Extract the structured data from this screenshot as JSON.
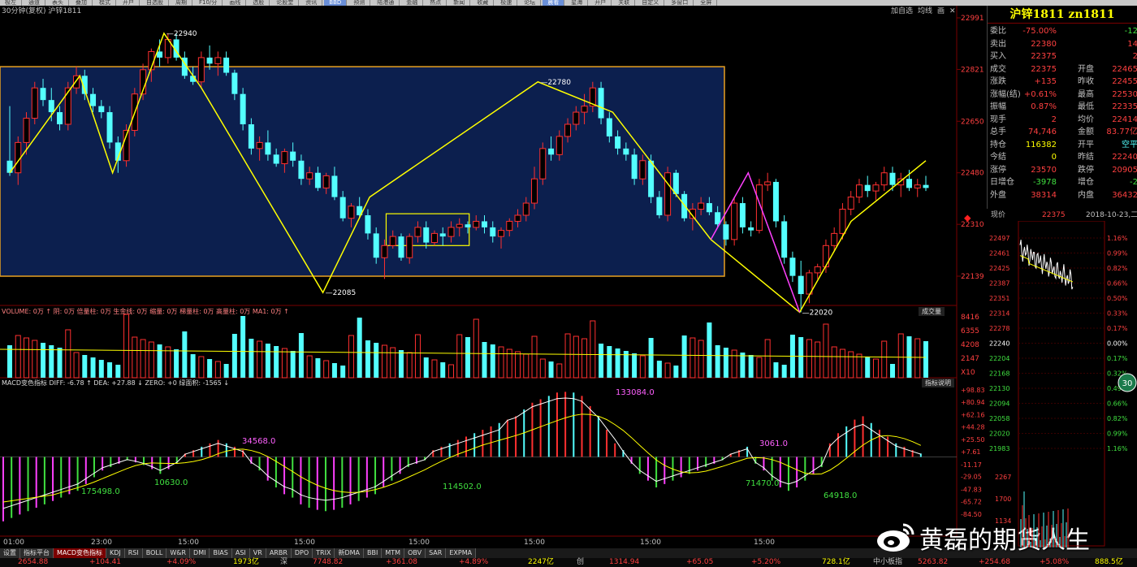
{
  "app": {
    "menu": [
      "极左",
      "通道",
      "表头",
      "叠加",
      "模式",
      "开户",
      "自选股",
      "周期",
      "F10/分",
      "画线",
      "选股",
      "论股堂",
      "资讯",
      "BBD",
      "预测",
      "陆港通",
      "金融",
      "热点",
      "新闻",
      "收藏",
      "极速",
      "论坛",
      "晨看",
      "星海",
      "开户",
      "关联",
      "自定义",
      "多窗口",
      "全屏"
    ],
    "menu_highlight": [
      13,
      22
    ]
  },
  "main_chart": {
    "header_label": "30分钟(复权) 沪锌1811",
    "toolbar": [
      "加自选",
      "均线",
      "画",
      "✕"
    ],
    "price_axis": [
      "22991",
      "22821",
      "22650",
      "22480",
      "22310",
      "22139"
    ],
    "annotations": [
      "22940",
      "22780",
      "22085",
      "22020"
    ],
    "k_series": [
      [
        22520,
        22700,
        22470,
        22480
      ],
      [
        22480,
        22600,
        22440,
        22580
      ],
      [
        22580,
        22680,
        22540,
        22660
      ],
      [
        22660,
        22780,
        22640,
        22760
      ],
      [
        22760,
        22790,
        22700,
        22720
      ],
      [
        22720,
        22760,
        22650,
        22680
      ],
      [
        22680,
        22700,
        22620,
        22640
      ],
      [
        22640,
        22780,
        22620,
        22760
      ],
      [
        22760,
        22830,
        22740,
        22800
      ],
      [
        22800,
        22820,
        22720,
        22740
      ],
      [
        22740,
        22760,
        22680,
        22700
      ],
      [
        22700,
        22720,
        22660,
        22680
      ],
      [
        22680,
        22700,
        22560,
        22580
      ],
      [
        22580,
        22600,
        22480,
        22520
      ],
      [
        22520,
        22640,
        22500,
        22620
      ],
      [
        22620,
        22760,
        22600,
        22740
      ],
      [
        22740,
        22840,
        22720,
        22820
      ],
      [
        22820,
        22890,
        22780,
        22880
      ],
      [
        22880,
        22920,
        22830,
        22860
      ],
      [
        22860,
        22940,
        22840,
        22920
      ],
      [
        22920,
        22940,
        22850,
        22860
      ],
      [
        22860,
        22880,
        22790,
        22800
      ],
      [
        22800,
        22830,
        22770,
        22780
      ],
      [
        22780,
        22880,
        22760,
        22860
      ],
      [
        22860,
        22900,
        22820,
        22840
      ],
      [
        22840,
        22880,
        22800,
        22860
      ],
      [
        22860,
        22880,
        22800,
        22810
      ],
      [
        22810,
        22820,
        22720,
        22740
      ],
      [
        22740,
        22760,
        22620,
        22640
      ],
      [
        22640,
        22660,
        22540,
        22560
      ],
      [
        22560,
        22600,
        22520,
        22580
      ],
      [
        22580,
        22620,
        22520,
        22540
      ],
      [
        22540,
        22560,
        22500,
        22510
      ],
      [
        22510,
        22560,
        22480,
        22550
      ],
      [
        22550,
        22580,
        22500,
        22520
      ],
      [
        22520,
        22540,
        22440,
        22460
      ],
      [
        22460,
        22500,
        22440,
        22480
      ],
      [
        22480,
        22500,
        22420,
        22430
      ],
      [
        22430,
        22480,
        22410,
        22470
      ],
      [
        22470,
        22500,
        22390,
        22400
      ],
      [
        22400,
        22420,
        22320,
        22330
      ],
      [
        22330,
        22380,
        22300,
        22370
      ],
      [
        22370,
        22400,
        22330,
        22340
      ],
      [
        22340,
        22360,
        22260,
        22280
      ],
      [
        22280,
        22300,
        22180,
        22200
      ],
      [
        22200,
        22260,
        22130,
        22240
      ],
      [
        22240,
        22290,
        22230,
        22270
      ],
      [
        22270,
        22280,
        22190,
        22200
      ],
      [
        22200,
        22280,
        22180,
        22270
      ],
      [
        22270,
        22320,
        22250,
        22300
      ],
      [
        22300,
        22320,
        22230,
        22250
      ],
      [
        22250,
        22290,
        22240,
        22280
      ],
      [
        22280,
        22300,
        22240,
        22270
      ],
      [
        22270,
        22320,
        22250,
        22300
      ],
      [
        22300,
        22330,
        22270,
        22310
      ],
      [
        22310,
        22320,
        22280,
        22300
      ],
      [
        22300,
        22340,
        22290,
        22320
      ],
      [
        22320,
        22340,
        22280,
        22300
      ],
      [
        22300,
        22320,
        22250,
        22270
      ],
      [
        22270,
        22300,
        22230,
        22290
      ],
      [
        22290,
        22330,
        22270,
        22320
      ],
      [
        22320,
        22360,
        22300,
        22340
      ],
      [
        22340,
        22400,
        22320,
        22380
      ],
      [
        22380,
        22500,
        22360,
        22460
      ],
      [
        22460,
        22580,
        22440,
        22560
      ],
      [
        22560,
        22600,
        22520,
        22540
      ],
      [
        22540,
        22620,
        22520,
        22600
      ],
      [
        22600,
        22660,
        22580,
        22640
      ],
      [
        22640,
        22700,
        22620,
        22680
      ],
      [
        22680,
        22740,
        22640,
        22700
      ],
      [
        22700,
        22780,
        22680,
        22760
      ],
      [
        22760,
        22780,
        22640,
        22660
      ],
      [
        22660,
        22680,
        22580,
        22600
      ],
      [
        22600,
        22620,
        22540,
        22560
      ],
      [
        22560,
        22580,
        22520,
        22540
      ],
      [
        22540,
        22560,
        22440,
        22460
      ],
      [
        22460,
        22540,
        22440,
        22520
      ],
      [
        22520,
        22540,
        22380,
        22400
      ],
      [
        22400,
        22420,
        22330,
        22340
      ],
      [
        22340,
        22500,
        22320,
        22480
      ],
      [
        22480,
        22490,
        22400,
        22410
      ],
      [
        22410,
        22420,
        22320,
        22330
      ],
      [
        22330,
        22380,
        22290,
        22360
      ],
      [
        22360,
        22400,
        22340,
        22380
      ],
      [
        22380,
        22400,
        22340,
        22350
      ],
      [
        22350,
        22370,
        22300,
        22310
      ],
      [
        22310,
        22320,
        22240,
        22260
      ],
      [
        22260,
        22400,
        22240,
        22380
      ],
      [
        22380,
        22400,
        22280,
        22300
      ],
      [
        22300,
        22320,
        22270,
        22290
      ],
      [
        22290,
        22460,
        22280,
        22440
      ],
      [
        22440,
        22480,
        22420,
        22450
      ],
      [
        22450,
        22460,
        22300,
        22320
      ],
      [
        22320,
        22340,
        22180,
        22200
      ],
      [
        22200,
        22220,
        22120,
        22140
      ],
      [
        22140,
        22190,
        22020,
        22080
      ],
      [
        22080,
        22160,
        22050,
        22150
      ],
      [
        22150,
        22180,
        22130,
        22170
      ],
      [
        22170,
        22260,
        22150,
        22240
      ],
      [
        22240,
        22300,
        22220,
        22280
      ],
      [
        22280,
        22380,
        22260,
        22360
      ],
      [
        22360,
        22420,
        22340,
        22400
      ],
      [
        22400,
        22460,
        22380,
        22440
      ],
      [
        22440,
        22470,
        22400,
        22420
      ],
      [
        22420,
        22450,
        22390,
        22440
      ],
      [
        22440,
        22500,
        22420,
        22480
      ],
      [
        22480,
        22500,
        22420,
        22440
      ],
      [
        22440,
        22480,
        22400,
        22460
      ],
      [
        22460,
        22490,
        22420,
        22430
      ],
      [
        22430,
        22460,
        22400,
        22440
      ],
      [
        22440,
        22470,
        22420,
        22430
      ]
    ]
  },
  "volume_panel": {
    "header": "VOLUME: 0万 ↑ 阴: 0万 倍量柱: 0万 生金线: 0万 缩量: 0万 梯量柱: 0万 高量柱: 0万 MA1: 0万 ↑",
    "right_button": "成交量",
    "axis": [
      "8416",
      "6355",
      "4208",
      "2147",
      "X10"
    ]
  },
  "macd_panel": {
    "header": "MACD变色指标 DIFF: -6.78 ↑ DEA: +27.88 ↓ ZERO: +0 绿面积: -1565 ↓",
    "right_button": "指标说明",
    "axis": [
      "+98.83",
      "+80.94",
      "+62.16",
      "+44.28",
      "+25.50",
      "+7.61",
      "-11.17",
      "-29.05",
      "-47.83",
      "-65.72",
      "-84.50"
    ],
    "area_labels": [
      "175498.0",
      "10630.0",
      "34568.0",
      "114502.0",
      "133084.0",
      "3061.0",
      "71470.0",
      "64918.0"
    ],
    "hist": [
      -95,
      -90,
      -85,
      -80,
      -75,
      -70,
      -65,
      -60,
      -55,
      -50,
      -40,
      -30,
      -20,
      -15,
      -10,
      -5,
      -8,
      -12,
      -18,
      -25,
      -18,
      -10,
      5,
      10,
      15,
      20,
      25,
      20,
      15,
      10,
      -10,
      -20,
      -35,
      -45,
      -55,
      -60,
      -70,
      -75,
      -78,
      -80,
      -78,
      -75,
      -70,
      -65,
      -60,
      -55,
      -45,
      -35,
      -25,
      -15,
      -10,
      -5,
      10,
      15,
      20,
      25,
      30,
      35,
      40,
      45,
      50,
      55,
      60,
      70,
      80,
      85,
      90,
      95,
      96,
      95,
      90,
      75,
      60,
      40,
      20,
      10,
      -10,
      -25,
      -35,
      -45,
      -40,
      -35,
      -30,
      -25,
      -20,
      -15,
      -10,
      -5,
      5,
      10,
      15,
      -10,
      -20,
      -35,
      -45,
      -50,
      -45,
      -35,
      -25,
      -15,
      20,
      35,
      45,
      55,
      60,
      50,
      40,
      30,
      20,
      15,
      10,
      5
    ]
  },
  "time_axis": [
    "01:00",
    "23:00",
    "15:00",
    "15:00",
    "15:00",
    "15:00",
    "15:00",
    "15:00"
  ],
  "quote_panel": {
    "title": "沪锌1811 zn1811",
    "rows": [
      {
        "l": "委比",
        "v": "-75.00%",
        "l2": "",
        "v2": "-12"
      },
      {
        "l": "卖出",
        "v": "22380",
        "l2": "",
        "v2": "14"
      },
      {
        "l": "买入",
        "v": "22375",
        "l2": "",
        "v2": "2"
      },
      {
        "l": "成交",
        "v": "22375",
        "l2": "开盘",
        "v2": "22465"
      },
      {
        "l": "涨跌",
        "v": "+135",
        "l2": "昨收",
        "v2": "22455"
      },
      {
        "l": "涨幅(结)",
        "v": "+0.61%",
        "l2": "最高",
        "v2": "22530"
      },
      {
        "l": "振幅",
        "v": "0.87%",
        "l2": "最低",
        "v2": "22335"
      },
      {
        "l": "现手",
        "v": "2",
        "l2": "均价",
        "v2": "22414"
      },
      {
        "l": "总手",
        "v": "74,746",
        "l2": "金额",
        "v2": "83.77亿"
      },
      {
        "l": "持仓",
        "v": "116382",
        "l2": "开平",
        "v2": "空平"
      },
      {
        "l": "今结",
        "v": "0",
        "l2": "昨结",
        "v2": "22240"
      },
      {
        "l": "涨停",
        "v": "23570",
        "l2": "跌停",
        "v2": "20905"
      },
      {
        "l": "日增仓",
        "v": "-3978",
        "l2": "增仓",
        "v2": "-2"
      },
      {
        "l": "外盘",
        "v": "38314",
        "l2": "内盘",
        "v2": "36432"
      }
    ]
  },
  "mini_chart": {
    "label": "现价",
    "price": "22375",
    "date": "2018-10-23,二",
    "left_axis": [
      "22497",
      "22461",
      "22425",
      "22387",
      "22351",
      "22314",
      "22278",
      "22240",
      "22204",
      "22168",
      "22130",
      "22094",
      "22058",
      "22020",
      "21983"
    ],
    "right_axis": [
      "1.16%",
      "0.99%",
      "0.82%",
      "0.66%",
      "0.50%",
      "0.33%",
      "0.17%",
      "0.00%",
      "0.17%",
      "0.32%",
      "0.49%",
      "0.66%",
      "0.82%",
      "0.99%",
      "1.16%"
    ],
    "vol_axis": [
      "2267",
      "1700",
      "1134"
    ],
    "badge": "30"
  },
  "tabs": [
    "设置",
    "指标平台",
    "MACD变色指标",
    "KDJ",
    "RSI",
    "BOLL",
    "W&R",
    "DMI",
    "BIAS",
    "ASI",
    "VR",
    "ARBR",
    "DPO",
    "TRIX",
    "新DMA",
    "BBI",
    "MTM",
    "OBV",
    "SAR",
    "EXPMA"
  ],
  "ticker": [
    {
      "t": "2654.88",
      "c": "#ff4040"
    },
    {
      "t": "+104.41",
      "c": "#ff4040"
    },
    {
      "t": "+4.09%",
      "c": "#ff4040"
    },
    {
      "t": "1973亿",
      "c": "#ffff00"
    },
    {
      "t": "深",
      "c": "#c0c0c0"
    },
    {
      "t": "7748.82",
      "c": "#ff4040"
    },
    {
      "t": "+361.08",
      "c": "#ff4040"
    },
    {
      "t": "+4.89%",
      "c": "#ff4040"
    },
    {
      "t": "2247亿",
      "c": "#ffff00"
    },
    {
      "t": "创",
      "c": "#c0c0c0"
    },
    {
      "t": "1314.94",
      "c": "#ff4040"
    },
    {
      "t": "+65.05",
      "c": "#ff4040"
    },
    {
      "t": "+5.20%",
      "c": "#ff4040"
    },
    {
      "t": "728.1亿",
      "c": "#ffff00"
    },
    {
      "t": "中小板指",
      "c": "#c0c0c0"
    },
    {
      "t": "5263.82",
      "c": "#ff4040"
    },
    {
      "t": "+254.68",
      "c": "#ff4040"
    },
    {
      "t": "+5.08%",
      "c": "#ff4040"
    },
    {
      "t": "888.5亿",
      "c": "#ffff00"
    }
  ],
  "watermark": "黄磊的期货人生",
  "colors": {
    "up": "#ff3030",
    "down": "#54ffff",
    "box": "#0c1f4e",
    "boxBorder": "#e8a020",
    "yellow": "#ffff00",
    "magenta": "#ff40ff",
    "green": "#40e040"
  }
}
